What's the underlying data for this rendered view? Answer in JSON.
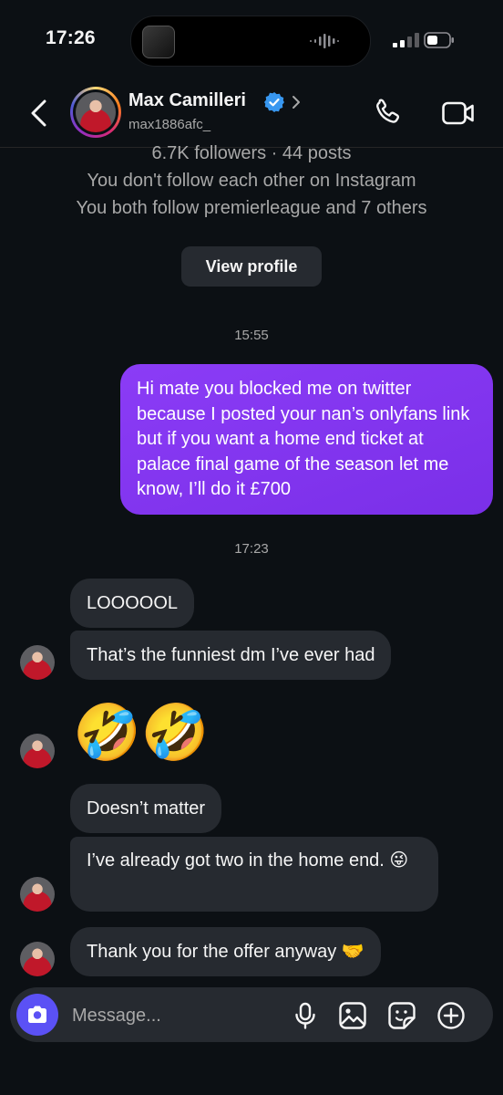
{
  "status_bar": {
    "time": "17:26"
  },
  "header": {
    "name": "Max Camilleri",
    "handle": "max1886afc_",
    "verified": true
  },
  "profile_info": {
    "stats": "6.7K followers · 44 posts",
    "follow_status": "You don't follow each other on Instagram",
    "mutual": "You both follow premierleague and 7 others",
    "view_profile_label": "View profile"
  },
  "messages": {
    "timestamp_1": "15:55",
    "outgoing_1": "Hi mate you blocked me on twitter because I posted your nan’s onlyfans link but if you want a home end ticket at palace final game of the season let me know, I’ll do it £700",
    "timestamp_2": "17:23",
    "incoming_1": "LOOOOOL",
    "incoming_2": "That’s the funniest dm I’ve ever had",
    "incoming_3_emoji": "🤣🤣",
    "incoming_4": "Doesn’t matter",
    "incoming_5": "I’ve already got two in the home end. 😜",
    "incoming_6": "Thank you for the offer anyway 🤝"
  },
  "composer": {
    "placeholder": "Message...",
    "icons": [
      "camera-icon",
      "microphone-icon",
      "gallery-icon",
      "sticker-icon",
      "add-icon"
    ]
  },
  "colors": {
    "background": "#0c1014",
    "outgoing_bubble": "#8b3cf6",
    "incoming_bubble": "#262a30",
    "camera_button": "#5b51f5",
    "verified_blue": "#3897f0"
  }
}
